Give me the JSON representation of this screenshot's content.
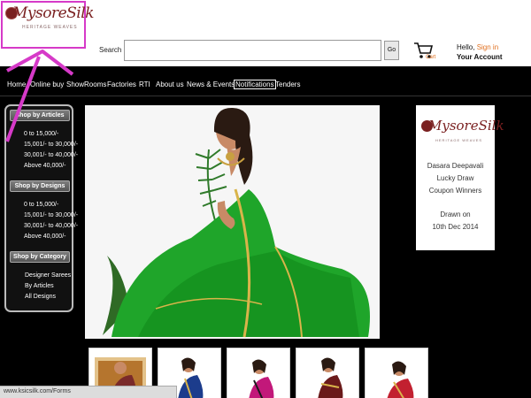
{
  "header": {
    "logo_text": "MysoreSilk",
    "logo_sub": "HERITAGE WEAVES",
    "search_label": "Search",
    "search_value": "",
    "go_label": "Go",
    "cart_label": "Cart",
    "hello_prefix": "Hello, ",
    "signin": "Sign in",
    "account": "Your Account"
  },
  "nav": {
    "items": [
      "Home",
      "Online buy",
      "ShowRooms",
      "Factories",
      "RTI",
      "About us",
      "News & Events",
      "Notifications",
      "Tenders"
    ],
    "active": "Notifications"
  },
  "sidebar": {
    "sections": [
      {
        "title": "Shop by Articles",
        "links": [
          "0 to 15,000/-",
          "15,001/- to 30,000/-",
          "30,001/- to 40,000/-",
          "Above 40,000/-"
        ]
      },
      {
        "title": "Shop by Designs",
        "links": [
          "0 to 15,000/-",
          "15,001/- to 30,000/-",
          "30,001/- to 40,000/-",
          "Above 40,000/-"
        ]
      },
      {
        "title": "Shop by Category",
        "links": [
          "Designer Sarees",
          "By Articles",
          "All Designs"
        ]
      }
    ]
  },
  "ad": {
    "logo_text": "MysoreSilk",
    "logo_sub": "HERITAGE WEAVES",
    "line1": "Dasara Deepavali",
    "line2": "Lucky Draw",
    "line3": "Coupon Winners",
    "line4": "Drawn on",
    "line5": "10th Dec 2014"
  },
  "colors": {
    "accent_orange": "#e07020",
    "brand_maroon": "#7a2020",
    "annotation_magenta": "#d63ac8",
    "saree_green": "#1fa52a"
  },
  "statusbar": {
    "text": "www.ksicsilk.com/Forms"
  }
}
